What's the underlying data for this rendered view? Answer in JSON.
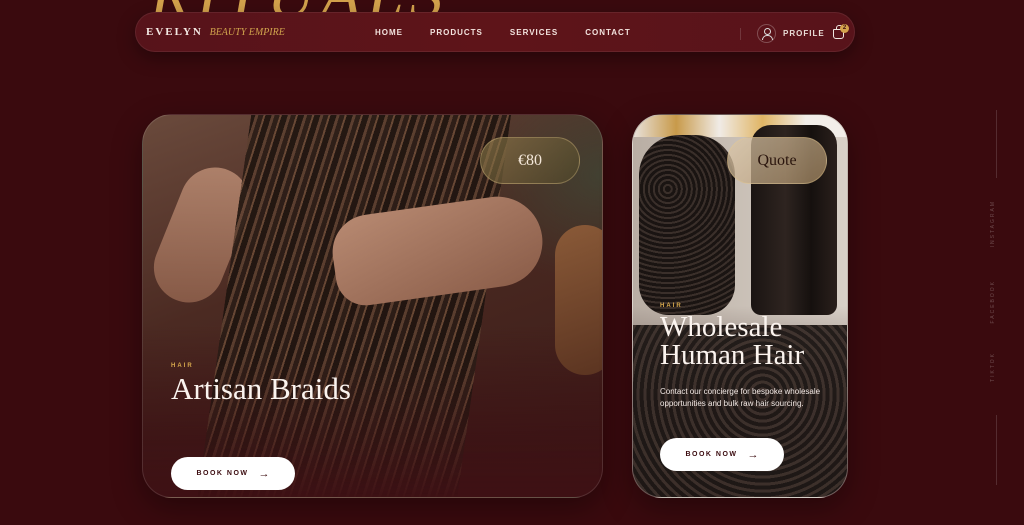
{
  "background": {
    "hero_text": "RITUALS"
  },
  "nav": {
    "brand": "EVELYN",
    "brand_sub": "BEAUTY EMPIRE",
    "links": [
      "HOME",
      "PRODUCTS",
      "SERVICES",
      "CONTACT"
    ],
    "profile_label": "PROFILE",
    "cart_count": "2"
  },
  "cards": [
    {
      "category": "HAIR",
      "title": "Artisan Braids",
      "price": "€80",
      "button": "BOOK NOW"
    },
    {
      "category": "HAIR",
      "title_line1": "Wholesale",
      "title_line2": "Human Hair",
      "price": "Quote",
      "description": "Contact our concierge for bespoke wholesale opportunities and bulk raw hair sourcing.",
      "button": "BOOK NOW"
    }
  ],
  "side": {
    "labels": [
      "INSTAGRAM",
      "FACEBOOK",
      "TIKTOK"
    ]
  },
  "colors": {
    "background": "#3a0a0e",
    "accent": "#d4a24c",
    "nav": "#5e1419"
  }
}
